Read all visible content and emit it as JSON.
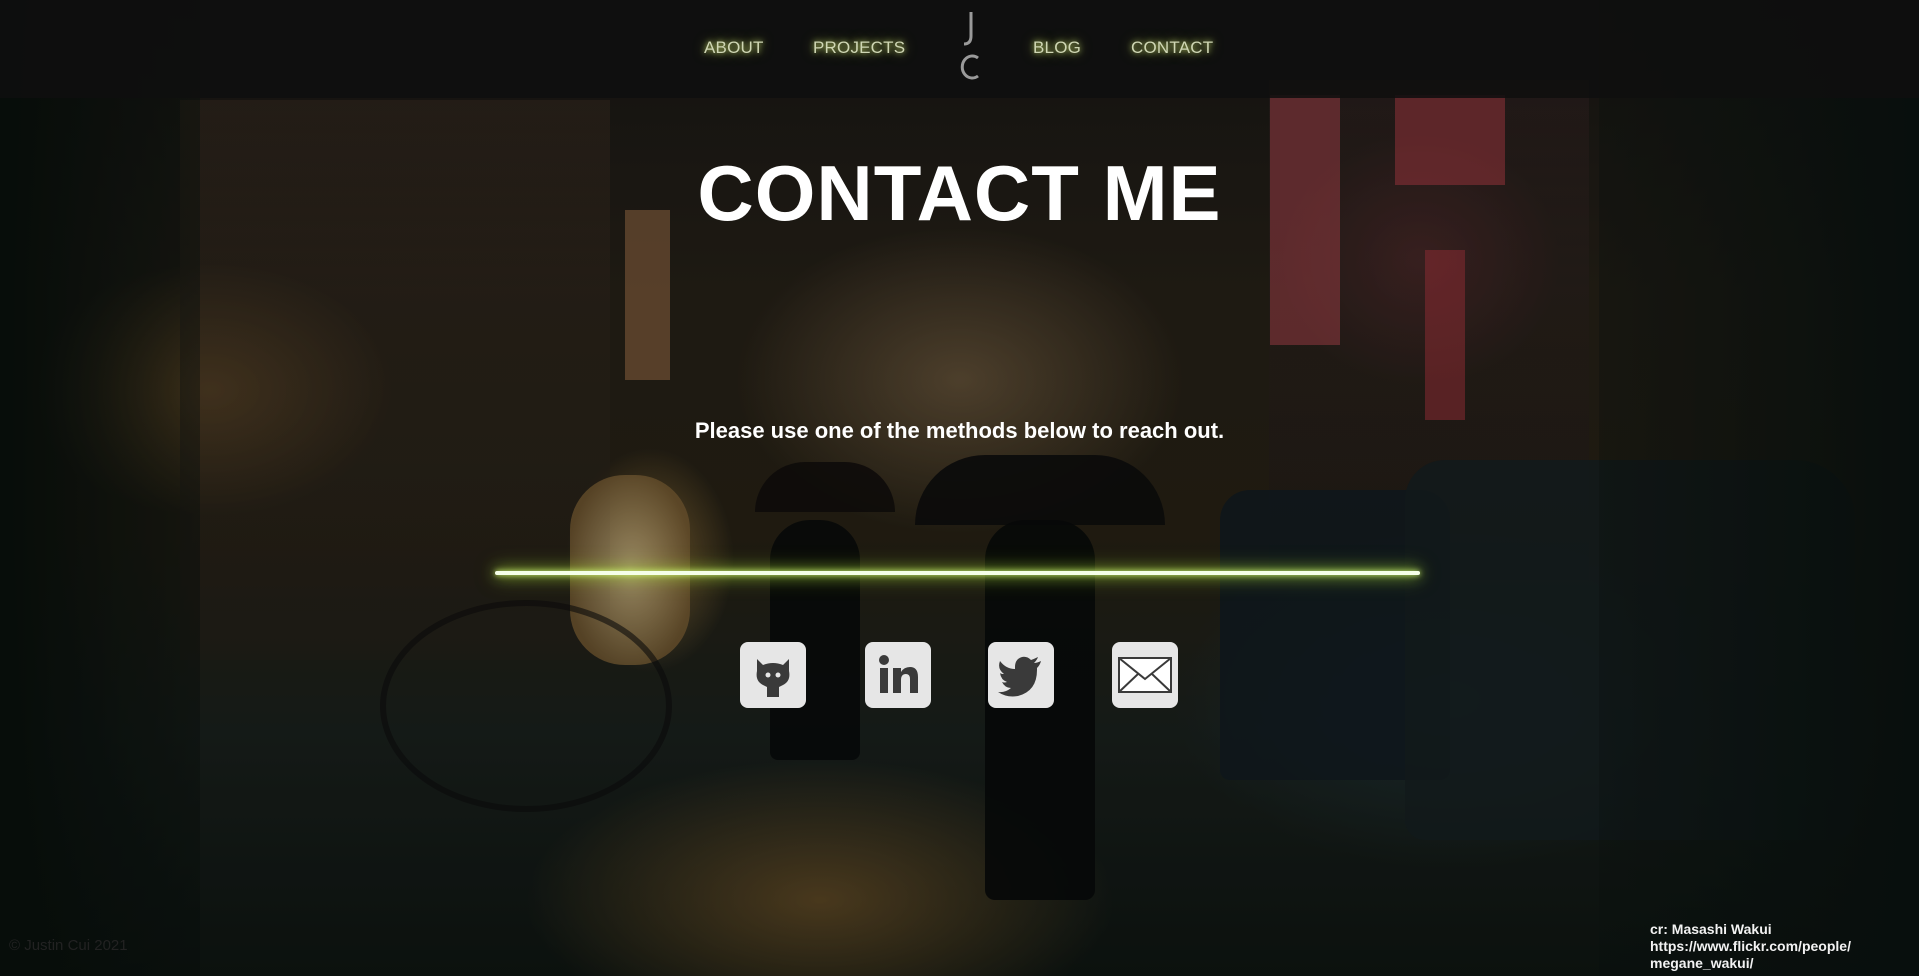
{
  "nav": {
    "links": [
      "ABOUT",
      "PROJECTS",
      "BLOG",
      "CONTACT"
    ],
    "logo_icon": "jc-monogram-logo",
    "glow_color": "#d8f070"
  },
  "main": {
    "title": "CONTACT ME",
    "subtitle": "Please use one of the methods below to reach out.",
    "divider_color": "#c8f040"
  },
  "social": [
    {
      "icon": "github-icon"
    },
    {
      "icon": "linkedin-icon"
    },
    {
      "icon": "twitter-icon"
    },
    {
      "icon": "email-icon"
    }
  ],
  "footer": {
    "copyright": "© Justin Cui 2021",
    "credit_line1": "cr: Masashi Wakui",
    "credit_line2": "https://www.flickr.com/people/",
    "credit_line3": "megane_wakui/"
  }
}
